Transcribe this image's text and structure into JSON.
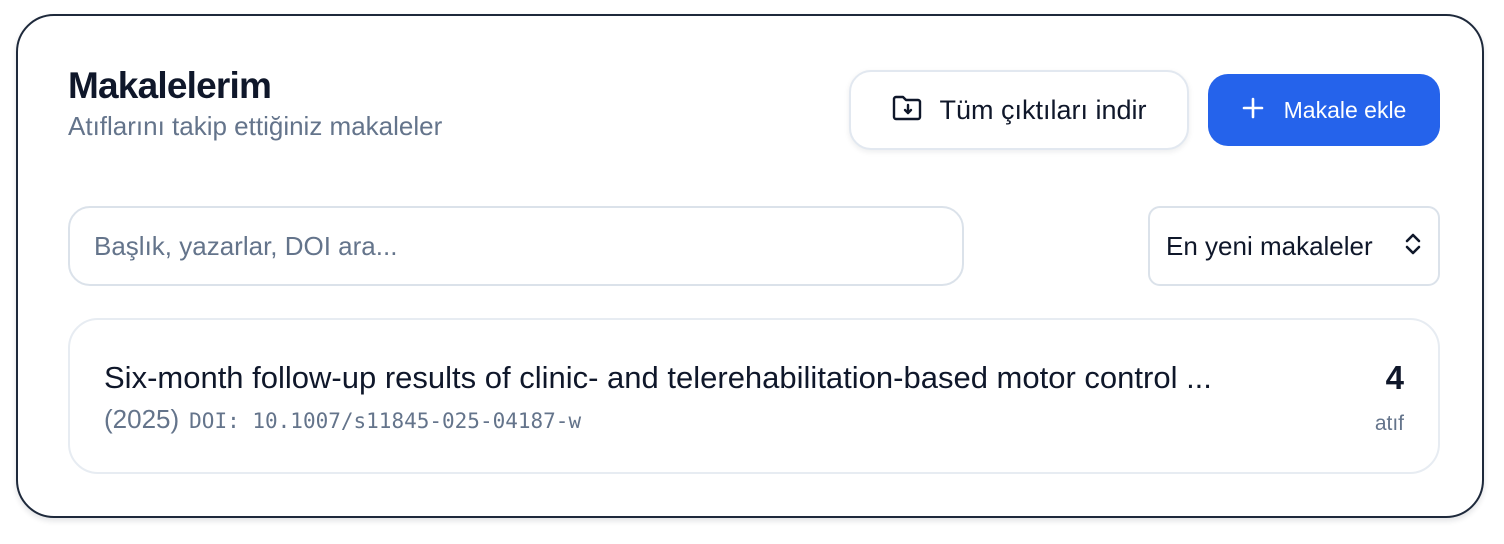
{
  "header": {
    "title": "Makalelerim",
    "subtitle": "Atıflarını takip ettiğiniz makaleler"
  },
  "actions": {
    "download_label": "Tüm çıktıları indir",
    "download_icon": "folder-download-icon",
    "add_label": "Makale ekle",
    "add_icon": "plus-icon"
  },
  "search": {
    "placeholder": "Başlık, yazarlar, DOI ara...",
    "value": ""
  },
  "sort": {
    "selected": "En yeni makaleler",
    "icon": "chevron-up-down-icon"
  },
  "articles": [
    {
      "title": "Six-month follow-up results of clinic- and telerehabilitation-based motor control ...",
      "year": "(2025)",
      "doi": "DOI: 10.1007/s11845-025-04187-w",
      "citation_count": "4",
      "citation_label": "atıf"
    }
  ],
  "colors": {
    "accent": "#2563eb",
    "text": "#0f172a",
    "muted": "#64748b",
    "border": "#e2e8f0"
  }
}
